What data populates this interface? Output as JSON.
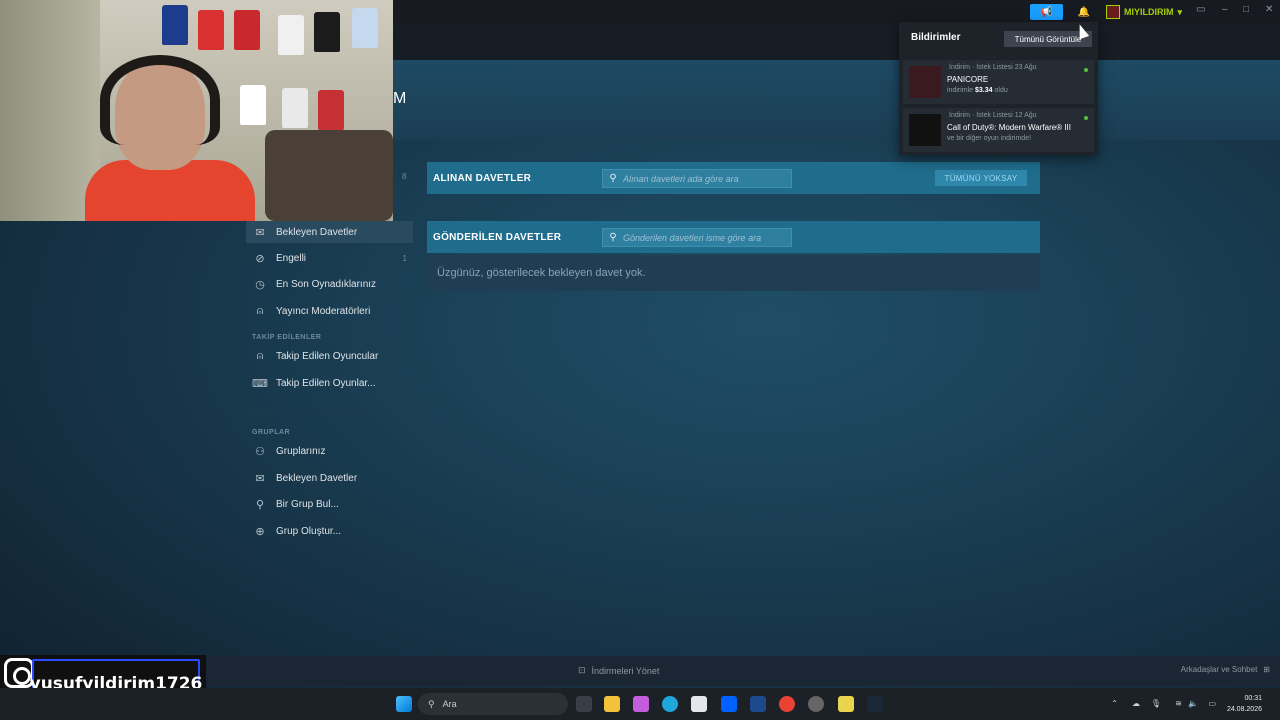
{
  "topbar": {
    "announce_icon": "megaphone-icon",
    "bell_icon": "bell-icon",
    "username": "MIYILDIRIM",
    "accent": "#1a9fff",
    "user_color": "#a4d007"
  },
  "page_header": {
    "partial_text": "M"
  },
  "sidebar": {
    "top_count": "8",
    "items": [
      {
        "label": "Bekleyen Davetler",
        "icon": "envelope-icon",
        "count": ""
      },
      {
        "label": "Engelli",
        "icon": "block-icon",
        "count": "1"
      },
      {
        "label": "En Son Oynadıklarınız",
        "icon": "clock-icon",
        "count": ""
      },
      {
        "label": "Yayıncı Moderatörleri",
        "icon": "person-icon",
        "count": ""
      }
    ],
    "section_followed": "TAKİP EDİLENLER",
    "followed": [
      {
        "label": "Takip Edilen Oyuncular",
        "icon": "person-follow-icon"
      },
      {
        "label": "Takip Edilen Oyunlar...",
        "icon": "gamepad-icon"
      }
    ],
    "section_groups": "GRUPLAR",
    "groups": [
      {
        "label": "Gruplarınız",
        "icon": "group-icon"
      },
      {
        "label": "Bekleyen Davetler",
        "icon": "envelope-icon"
      },
      {
        "label": "Bir Grup Bul...",
        "icon": "search-icon"
      },
      {
        "label": "Grup Oluştur...",
        "icon": "plus-icon"
      }
    ]
  },
  "received": {
    "title": "ALINAN DAVETLER",
    "search_placeholder": "Alınan davetleri ada göre ara",
    "ignore_all": "TÜMÜNÜ YOKSAY"
  },
  "sent": {
    "title": "GÖNDERİLEN DAVETLER",
    "search_placeholder": "Gönderilen davetleri isme göre ara",
    "empty_message": "Üzgünüz, gösterilecek bekleyen davet yok."
  },
  "notifications": {
    "title": "Bildirimler",
    "view_all": "Tümünü Görüntüle",
    "items": [
      {
        "meta": "İndirim · İstek Listesi  23 Ağu",
        "name": "PANICORE",
        "sub_prefix": "indirimle",
        "price": "$3.34",
        "sub_suffix": "oldu"
      },
      {
        "meta": "İndirim · İstek Listesi  12 Ağu",
        "name": "Call of Duty®: Modern Warfare® III",
        "sub": "ve bir diğer oyun indirimde!"
      }
    ]
  },
  "bottombar": {
    "downloads": "İndirmeleri Yönet",
    "friends": "Arkadaşlar ve Sohbet"
  },
  "overlay": {
    "instagram_handle": "yusufyildirim1726"
  },
  "taskbar": {
    "search": "Ara",
    "time": "00:31",
    "date": "24.08.2026"
  }
}
